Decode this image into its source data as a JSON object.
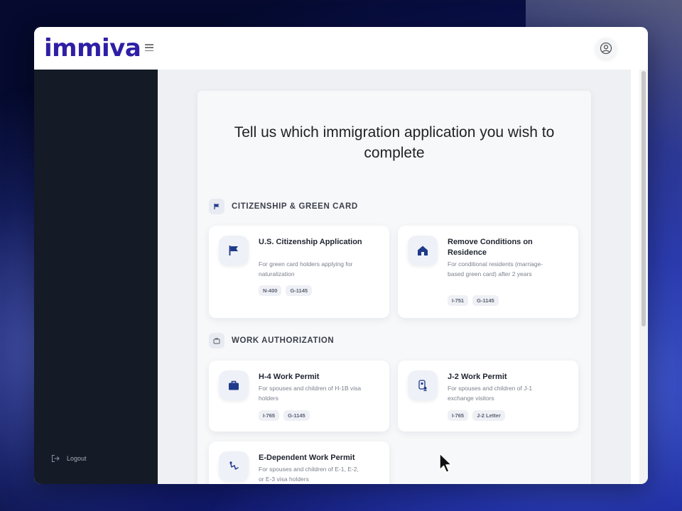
{
  "app": {
    "logo": "immiva"
  },
  "sidebar": {
    "logout_label": "Logout"
  },
  "main": {
    "title": "Tell us which immigration application you wish to complete",
    "sections": [
      {
        "label": "CITIZENSHIP & GREEN CARD",
        "icon": "flag-icon",
        "options": [
          {
            "title": "U.S. Citizenship Application",
            "desc": "For green card holders applying for naturalization",
            "icon": "flag-icon",
            "tags": [
              "N-400",
              "G-1145"
            ]
          },
          {
            "title": "Remove Conditions on Residence",
            "desc": "For conditional residents (marriage-based green card) after 2 years",
            "icon": "house-icon",
            "tags": [
              "I-751",
              "G-1145"
            ]
          }
        ]
      },
      {
        "label": "WORK AUTHORIZATION",
        "icon": "briefcase-icon",
        "options": [
          {
            "title": "H-4 Work Permit",
            "desc": "For spouses and children of H-1B visa holders",
            "icon": "briefcase-icon",
            "tags": [
              "I-765",
              "G-1145"
            ]
          },
          {
            "title": "J-2 Work Permit",
            "desc": "For spouses and children of J-1 exchange visitors",
            "icon": "id-badge-icon",
            "tags": [
              "I-765",
              "J-2 Letter"
            ]
          },
          {
            "title": "E-Dependent Work Permit",
            "desc": "For spouses and children of E-1, E-2, or E-3 visa holders",
            "icon": "route-icon",
            "tags": []
          }
        ]
      }
    ]
  },
  "colors": {
    "brand": "#2e1fa6",
    "sidebar": "#141a26",
    "icon_blue": "#1f3a8a"
  }
}
